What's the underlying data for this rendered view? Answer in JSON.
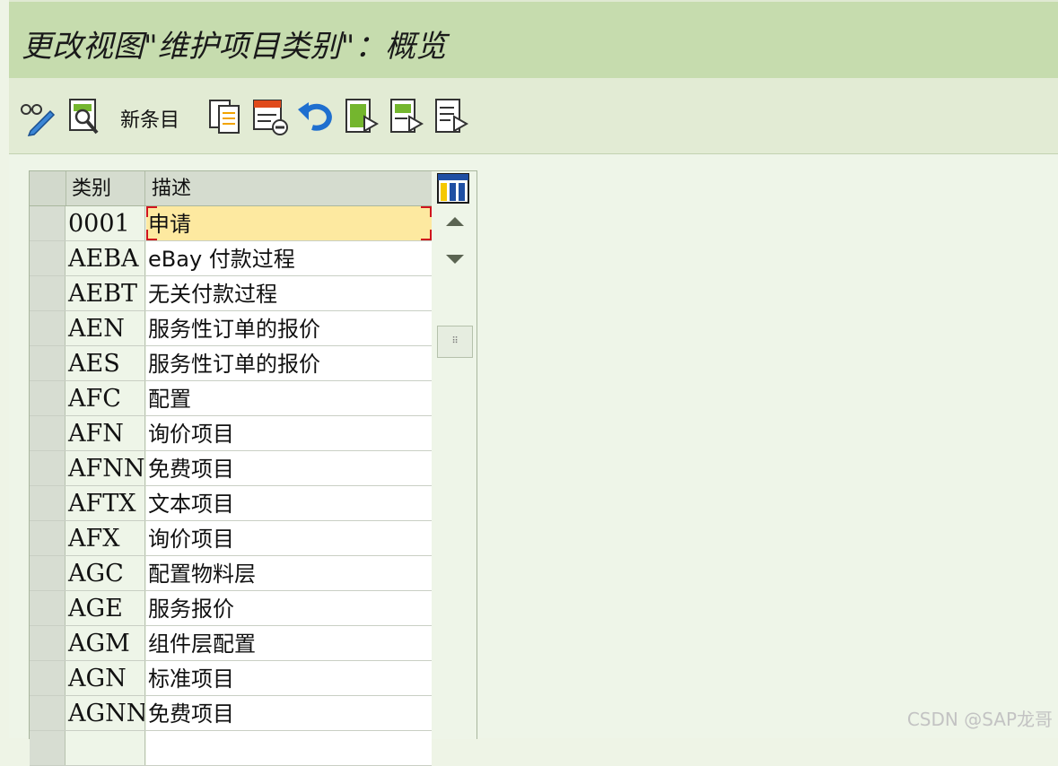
{
  "title": "更改视图\"维护项目类别\"：概览",
  "toolbar": {
    "new_entries_label": "新条目",
    "icons": [
      "display-change-icon",
      "find-icon",
      "copy-icon",
      "delete-icon",
      "undo-icon",
      "select-all-icon",
      "select-block-icon",
      "deselect-all-icon"
    ]
  },
  "table": {
    "headers": {
      "category": "类别",
      "description": "描述"
    },
    "rows": [
      {
        "code": "0001",
        "desc": "申请"
      },
      {
        "code": "AEBA",
        "desc": "eBay 付款过程"
      },
      {
        "code": "AEBT",
        "desc": "无关付款过程"
      },
      {
        "code": "AEN",
        "desc": "服务性订单的报价"
      },
      {
        "code": "AES",
        "desc": "服务性订单的报价"
      },
      {
        "code": "AFC",
        "desc": "配置"
      },
      {
        "code": "AFN",
        "desc": "询价项目"
      },
      {
        "code": "AFNN",
        "desc": "免费项目"
      },
      {
        "code": "AFTX",
        "desc": "文本项目"
      },
      {
        "code": "AFX",
        "desc": "询价项目"
      },
      {
        "code": "AGC",
        "desc": "配置物料层"
      },
      {
        "code": "AGE",
        "desc": "服务报价"
      },
      {
        "code": "AGM",
        "desc": "组件层配置"
      },
      {
        "code": "AGN",
        "desc": "标准项目"
      },
      {
        "code": "AGNN",
        "desc": "免费项目"
      },
      {
        "code": "",
        "desc": ""
      }
    ]
  },
  "watermark": "CSDN @SAP龙哥",
  "colors": {
    "title_bar": "#c6dcae",
    "toolbar": "#e2ebd4",
    "active_cell": "#fde9a0",
    "focus": "#d0141d",
    "icon_green": "#74b62e",
    "icon_blue": "#1f6fcf"
  }
}
